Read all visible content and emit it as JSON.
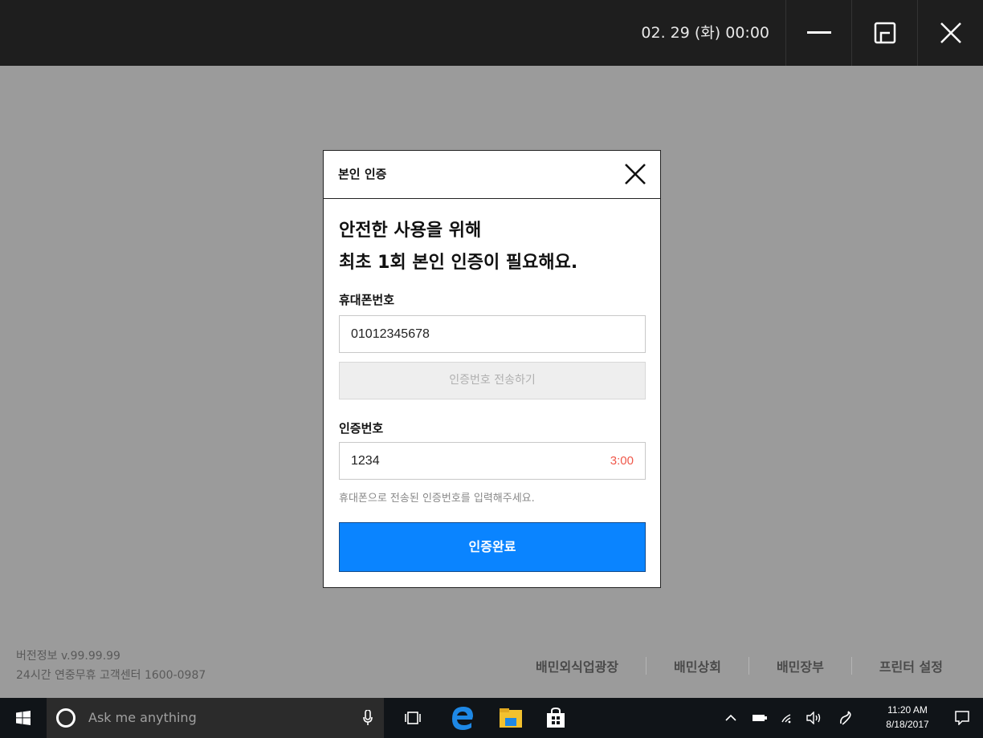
{
  "titlebar": {
    "datetime": "02. 29 (화) 00:00"
  },
  "modal": {
    "title": "본인 인증",
    "headline_line1": "안전한 사용을 위해",
    "headline_line2": "최초 1회 본인 인증이 필요해요.",
    "phone_label": "휴대폰번호",
    "phone_value": "01012345678",
    "send_button": "인증번호 전송하기",
    "code_label": "인증번호",
    "code_value": "1234",
    "timer": "3:00",
    "hint": "휴대폰으로 전송된 인증번호를 입력해주세요.",
    "confirm_button": "인증완료"
  },
  "footer": {
    "version": "버전정보 v.99.99.99",
    "support": "24시간 연중무휴 고객센터 1600-0987",
    "links": [
      "배민외식업광장",
      "배민상회",
      "배민장부",
      "프린터 설정"
    ]
  },
  "taskbar": {
    "search_placeholder": "Ask me anything",
    "clock_time": "11:20 AM",
    "clock_date": "8/18/2017"
  },
  "colors": {
    "accent": "#0a84ff",
    "timer": "#f0584a",
    "overlay": "#9b9b9b",
    "titlebar": "#1e1e1e"
  }
}
